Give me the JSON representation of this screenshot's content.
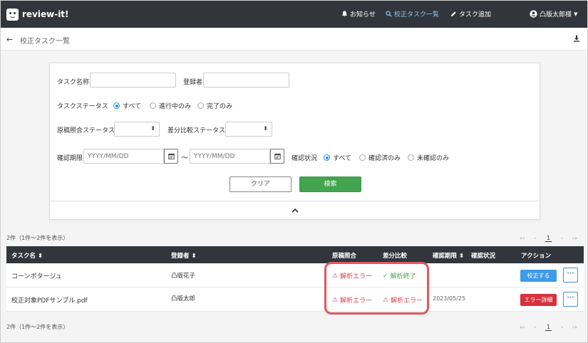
{
  "app": {
    "name": "review-it!"
  },
  "nav": {
    "notice": "お知らせ",
    "task_list": "校正タスク一覧",
    "add_task": "タスク追加",
    "user": "凸版太郎様"
  },
  "header": {
    "title": "校正タスク一覧"
  },
  "search": {
    "task_name_label": "タスク名称",
    "registrant_label": "登録者",
    "status_label": "タスクステータス",
    "status_options": [
      "すべて",
      "進行中のみ",
      "完了のみ"
    ],
    "status_selected": "すべて",
    "manuscript_label": "原稿照合ステータス",
    "diff_label": "差分比較ステータス",
    "deadline_label": "確認期限",
    "date_placeholder": "YYYY/MM/DD",
    "range_sep": "〜",
    "confirm_label": "確認状況",
    "confirm_options": [
      "すべて",
      "確認済のみ",
      "未確認のみ"
    ],
    "confirm_selected": "すべて",
    "clear_label": "クリア",
    "search_label": "検索"
  },
  "results": {
    "count_text": "2件（1件〜2件を表示）",
    "pager": {
      "first": "«‹",
      "prev": "‹",
      "current": "1",
      "next": "›",
      "last": "›»"
    },
    "columns": [
      "タスク名",
      "登録者",
      "原稿照合",
      "差分比較",
      "確認期限",
      "確認状況",
      "アクション"
    ],
    "rows": [
      {
        "task_name": "コーンポタージュ",
        "registrant": "凸版花子",
        "manuscript": "解析エラー",
        "manuscript_state": "error",
        "diff": "解析終了",
        "diff_state": "ok",
        "deadline": "",
        "confirm": "",
        "action": "校正する",
        "action_color": "#3d9be9"
      },
      {
        "task_name": "校正対象PDFサンプル.pdf",
        "registrant": "凸版太郎",
        "manuscript": "解析エラー",
        "manuscript_state": "error",
        "diff": "解析エラー",
        "diff_state": "error",
        "deadline": "2023/05/25",
        "confirm": "",
        "action": "エラー詳細",
        "action_color": "#d7323c"
      }
    ],
    "more_label": "···"
  },
  "colors": {
    "navbar": "#32363c",
    "accent": "#2f8fd8",
    "success": "#43a34f",
    "error": "#d9414b",
    "highlight": "#e0575d"
  }
}
